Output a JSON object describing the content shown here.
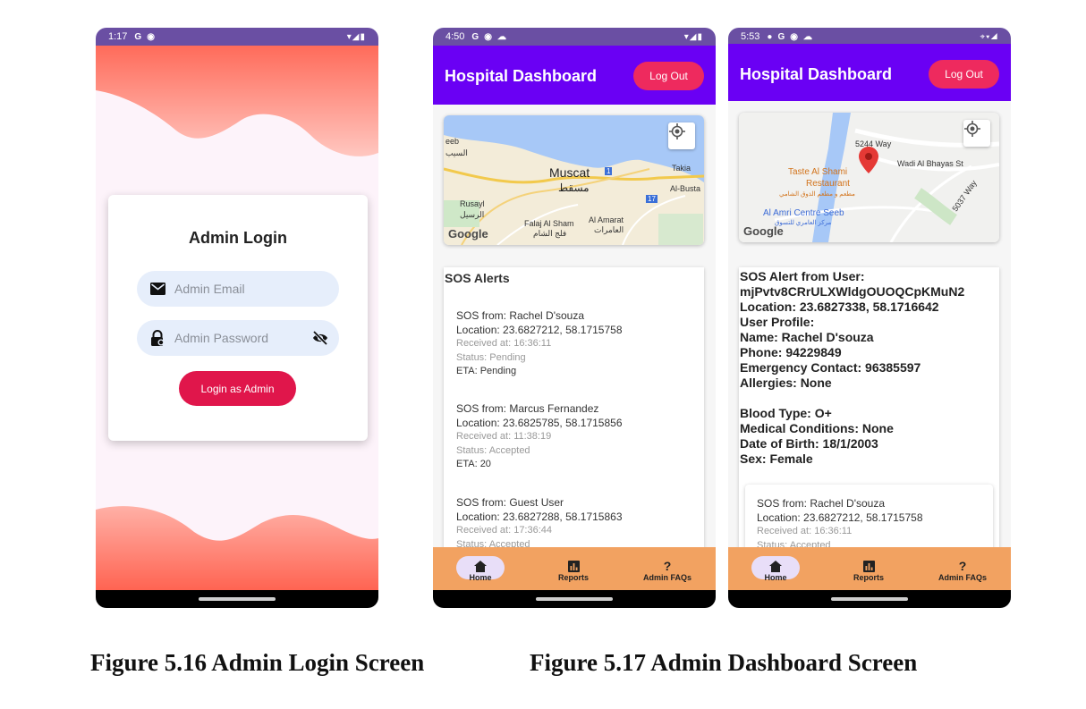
{
  "login_phone": {
    "status_time": "1:17",
    "status_icons": [
      "G",
      "◉"
    ],
    "card_title": "Admin Login",
    "email_placeholder": "Admin Email",
    "password_placeholder": "Admin Password",
    "login_button": "Login as Admin",
    "colors": {
      "wave": "#ff6f61",
      "card_bg": "#ffffff",
      "button": "#e0164b",
      "field_bg": "#e6eefb"
    }
  },
  "dashboard_phone": {
    "status_time": "4:50",
    "status_icons": [
      "G",
      "◉",
      "☁"
    ],
    "app_title": "Hospital Dashboard",
    "logout_button": "Log Out",
    "map": {
      "labels": [
        "eeb",
        "السيب",
        "Muscat",
        "مسقط",
        "Takia",
        "Al-Busta",
        "Rusayl",
        "الرسيل",
        "Falaj Al Sham",
        "فلج الشام",
        "Al Amarat",
        "العامرات",
        "1",
        "17"
      ],
      "brand": "Google"
    },
    "alerts_title": "SOS Alerts",
    "alerts": [
      {
        "from": "SOS from: Rachel D'souza",
        "location": "Location: 23.6827212, 58.1715758",
        "received": "Received at: 16:36:11",
        "status": "Status: Pending",
        "eta": "ETA: Pending"
      },
      {
        "from": "SOS from: Marcus Fernandez",
        "location": "Location: 23.6825785, 58.1715856",
        "received": "Received at: 11:38:19",
        "status": "Status: Accepted",
        "eta": "ETA: 20"
      },
      {
        "from": "SOS from: Guest User",
        "location": "Location: 23.6827288, 58.1715863",
        "received": "Received at: 17:36:44",
        "status": "Status: Accepted"
      }
    ],
    "nav": {
      "home": "Home",
      "reports": "Reports",
      "faqs": "Admin FAQs"
    },
    "colors": {
      "appbar": "#6a00f4",
      "logout": "#ee2a5e",
      "bottom_nav": "#f2a261",
      "active_pill": "#e8def8"
    }
  },
  "detail_phone": {
    "status_time": "5:53",
    "status_icons": [
      "●",
      "G",
      "◉",
      "☁"
    ],
    "app_title": "Hospital Dashboard",
    "logout_button": "Log Out",
    "map": {
      "labels": [
        "5244 Way",
        "Wadi Al Bhayas St",
        "Taste Al Shami",
        "Restaurant",
        "مطعم و مطعم الذوق الشامي",
        "Al Amri Centre Seeb",
        "مركز العامري للتسوق",
        "5037 Way",
        "Google"
      ]
    },
    "detail_lines": [
      "SOS Alert from User:",
      "mjPvtv8CRrULXWldgOUOQCpKMuN2",
      "Location: 23.6827338, 58.1716642",
      "User Profile:",
      "Name: Rachel D'souza",
      "Phone: 94229849",
      "Emergency Contact: 96385597",
      "Allergies: None",
      "",
      "Blood Type: O+",
      "Medical Conditions: None",
      "Date of Birth: 18/1/2003",
      "Sex: Female"
    ],
    "inner_alert": {
      "from": "SOS from: Rachel D'souza",
      "location": "Location: 23.6827212, 58.1715758",
      "received": "Received at: 16:36:11",
      "status": "Status: Accepted"
    },
    "nav": {
      "home": "Home",
      "reports": "Reports",
      "faqs": "Admin FAQs"
    }
  },
  "captions": {
    "left": "Figure 5.16 Admin Login Screen",
    "right": "Figure 5.17 Admin Dashboard Screen"
  }
}
